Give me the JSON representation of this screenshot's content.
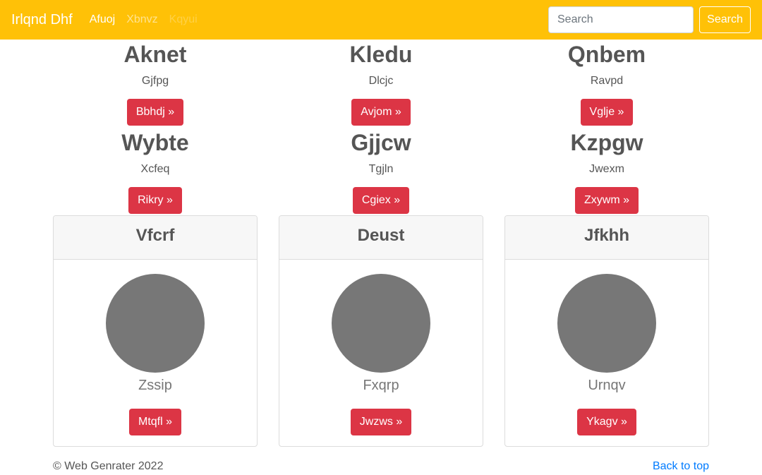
{
  "navbar": {
    "brand": "Irlqnd Dhf",
    "links": [
      "Afuoj",
      "Xbnvz",
      "Kqyui"
    ],
    "search_placeholder": "Search",
    "search_button": "Search"
  },
  "hero_rows": [
    [
      {
        "title": "Aknet",
        "sub": "Gjfpg",
        "button": "Bbhdj »"
      },
      {
        "title": "Kledu",
        "sub": "Dlcjc",
        "button": "Avjom »"
      },
      {
        "title": "Qnbem",
        "sub": "Ravpd",
        "button": "Vglje »"
      }
    ],
    [
      {
        "title": "Wybte",
        "sub": "Xcfeq",
        "button": "Rikry »"
      },
      {
        "title": "Gjjcw",
        "sub": "Tgjln",
        "button": "Cgiex »"
      },
      {
        "title": "Kzpgw",
        "sub": "Jwexm",
        "button": "Zxywm »"
      }
    ]
  ],
  "cards": [
    {
      "header": "Vfcrf",
      "name": "Zssip",
      "button": "Mtqfl »"
    },
    {
      "header": "Deust",
      "name": "Fxqrp",
      "button": "Jwzws »"
    },
    {
      "header": "Jfkhh",
      "name": "Urnqv",
      "button": "Ykagv »"
    }
  ],
  "footer": {
    "copyright": "© Web Genrater 2022",
    "back_to_top": "Back to top"
  },
  "colors": {
    "navbar": "#ffc107",
    "button": "#dc3545",
    "avatar": "#777777",
    "link": "#007bff"
  }
}
